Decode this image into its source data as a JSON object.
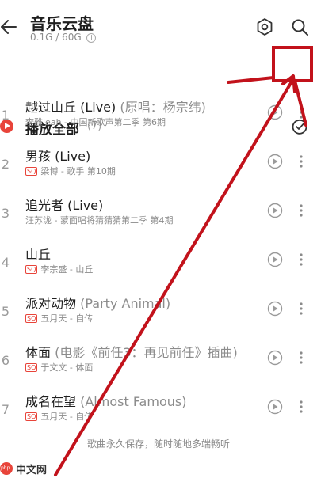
{
  "header": {
    "title": "音乐云盘",
    "storage": "0.1G / 60G",
    "info_glyph": "i"
  },
  "playall": {
    "label": "播放全部",
    "count": "(7)"
  },
  "songs": [
    {
      "index": "1",
      "title": "越过山丘 (Live)",
      "extra": "(原唱：杨宗纬)",
      "sq": false,
      "meta": "李雅leah - 中国新歌声第二季 第6期"
    },
    {
      "index": "2",
      "title": "男孩 (Live)",
      "extra": "",
      "sq": true,
      "sq_label": "SQ",
      "meta": "梁博 - 歌手 第10期"
    },
    {
      "index": "3",
      "title": "追光者 (Live)",
      "extra": "",
      "sq": false,
      "meta": "汪苏泷 - 蒙面唱将猜猜猜第二季 第4期"
    },
    {
      "index": "4",
      "title": "山丘",
      "extra": "",
      "sq": true,
      "sq_label": "SQ",
      "meta": "李宗盛 - 山丘"
    },
    {
      "index": "5",
      "title": "派对动物",
      "extra": "(Party Animal)",
      "sq": true,
      "sq_label": "SQ",
      "meta": "五月天 - 自传"
    },
    {
      "index": "6",
      "title": "体面",
      "extra": "(电影《前任3：再见前任》插曲)",
      "sq": true,
      "sq_label": "SQ",
      "meta": "于文文 - 体面"
    },
    {
      "index": "7",
      "title": "成名在望",
      "extra": "(Almost Famous)",
      "sq": true,
      "sq_label": "SQ",
      "meta": "五月天 - 自传"
    }
  ],
  "footer": {
    "text": "歌曲永久保存，随时随地多端畅听"
  },
  "watermark": {
    "text": "中文网"
  },
  "colors": {
    "accent": "#e8443a",
    "annotation": "#c2121b"
  }
}
